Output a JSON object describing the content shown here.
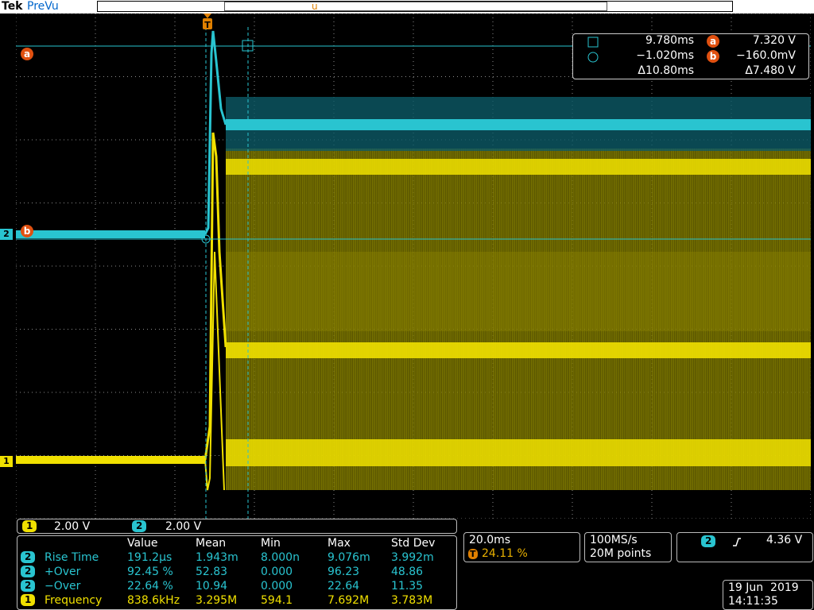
{
  "header": {
    "brand": "Tek",
    "mode": "PreVu",
    "trigger_marker": "T",
    "trigger_pos_marker": "u"
  },
  "colors": {
    "ch1": "#f0e000",
    "ch2": "#29c4d0",
    "cursor_label": "#e05010",
    "mode_text": "#0066cc",
    "grid": "#8a8a8a"
  },
  "channel_markers": {
    "ch1": "1",
    "ch2": "2"
  },
  "cursor_labels": {
    "a": "a",
    "b": "b"
  },
  "cursor_readout": {
    "time1": "9.780ms",
    "time2": "−1.020ms",
    "delta_t": "Δ10.80ms",
    "a_value": "7.320 V",
    "b_value": "−160.0mV",
    "delta_v": "Δ7.480 V"
  },
  "vertical": {
    "ch1_num": "1",
    "ch1_scale": "2.00 V",
    "ch2_num": "2",
    "ch2_scale": "2.00 V"
  },
  "measurements": {
    "headers": [
      "Value",
      "Mean",
      "Min",
      "Max",
      "Std Dev"
    ],
    "rows": [
      {
        "ch": "2",
        "name": "Rise Time",
        "value": "191.2µs",
        "mean": "1.943m",
        "min": "8.000n",
        "max": "9.076m",
        "std": "3.992m"
      },
      {
        "ch": "2",
        "name": "+Over",
        "value": "92.45 %",
        "mean": "52.83",
        "min": "0.000",
        "max": "96.23",
        "std": "48.86"
      },
      {
        "ch": "2",
        "name": "−Over",
        "value": "22.64 %",
        "mean": "10.94",
        "min": "0.000",
        "max": "22.64",
        "std": "11.35"
      },
      {
        "ch": "1",
        "name": "Frequency",
        "value": "838.6kHz",
        "mean": "3.295M",
        "min": "594.1",
        "max": "7.692M",
        "std": "3.783M"
      }
    ]
  },
  "horizontal": {
    "scale": "20.0ms",
    "trig_icon": "T",
    "position": "24.11 %"
  },
  "acquisition": {
    "rate": "100MS/s",
    "length": "20M points"
  },
  "trigger": {
    "source": "2",
    "slope_icon": "rising-edge-icon",
    "level": "4.36 V"
  },
  "datetime": {
    "date": "19 Jun  2019",
    "time": "14:11:35"
  }
}
